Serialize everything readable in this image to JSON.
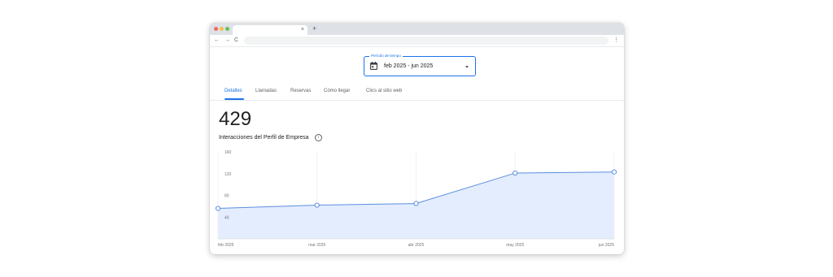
{
  "browser": {
    "dots": [
      "#ed6a5e",
      "#f5bf4f",
      "#61c554"
    ],
    "tab_close": "×",
    "new_tab": "+",
    "back": "←",
    "forward": "→",
    "reload": "C",
    "menu": "⋮"
  },
  "period": {
    "label": "Período de tiempo",
    "value": "feb 2025 - jun 2025",
    "icon": "calendar-icon"
  },
  "tabs": [
    {
      "label": "Detalles",
      "active": true
    },
    {
      "label": "Llamadas"
    },
    {
      "label": "Reservas"
    },
    {
      "label": "Cómo llegar"
    },
    {
      "label": "Clics al sitio web"
    }
  ],
  "metric": {
    "value": "429",
    "label": "Interacciones del Perfil de Empresa",
    "info_icon": "i"
  },
  "colors": {
    "accent": "#1a73e8",
    "line": "#5b8ee0",
    "area": "#e3edfd"
  },
  "chart_data": {
    "type": "area",
    "categories": [
      "feb 2025",
      "mar 2025",
      "abr 2025",
      "may 2025",
      "jun 2025"
    ],
    "values": [
      56,
      62,
      65,
      121,
      123
    ],
    "ylim": [
      0,
      160
    ],
    "yticks": [
      "160",
      "120",
      "80",
      "40"
    ],
    "xlabel": "",
    "ylabel": "",
    "grid": "vertical",
    "legend": "none"
  }
}
